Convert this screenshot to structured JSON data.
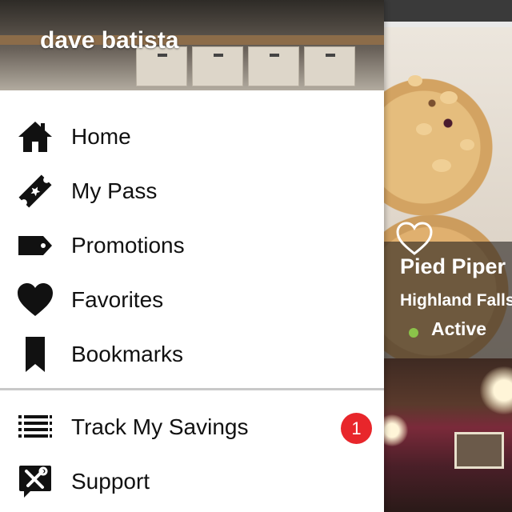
{
  "drawer": {
    "user_name": "dave batista",
    "menu_primary": [
      {
        "label": "Home",
        "icon": "home-icon"
      },
      {
        "label": "My Pass",
        "icon": "ticket-icon"
      },
      {
        "label": "Promotions",
        "icon": "tag-icon"
      },
      {
        "label": "Favorites",
        "icon": "heart-icon"
      },
      {
        "label": "Bookmarks",
        "icon": "bookmark-icon"
      }
    ],
    "menu_secondary": [
      {
        "label": "Track My Savings",
        "icon": "list-icon",
        "badge": "1"
      },
      {
        "label": "Support",
        "icon": "tools-icon"
      }
    ]
  },
  "listing": {
    "name": "Pied Piper",
    "location": "Highland Falls",
    "status": "Active",
    "status_color": "#8bc34a",
    "badge_color": "#e8262b"
  }
}
